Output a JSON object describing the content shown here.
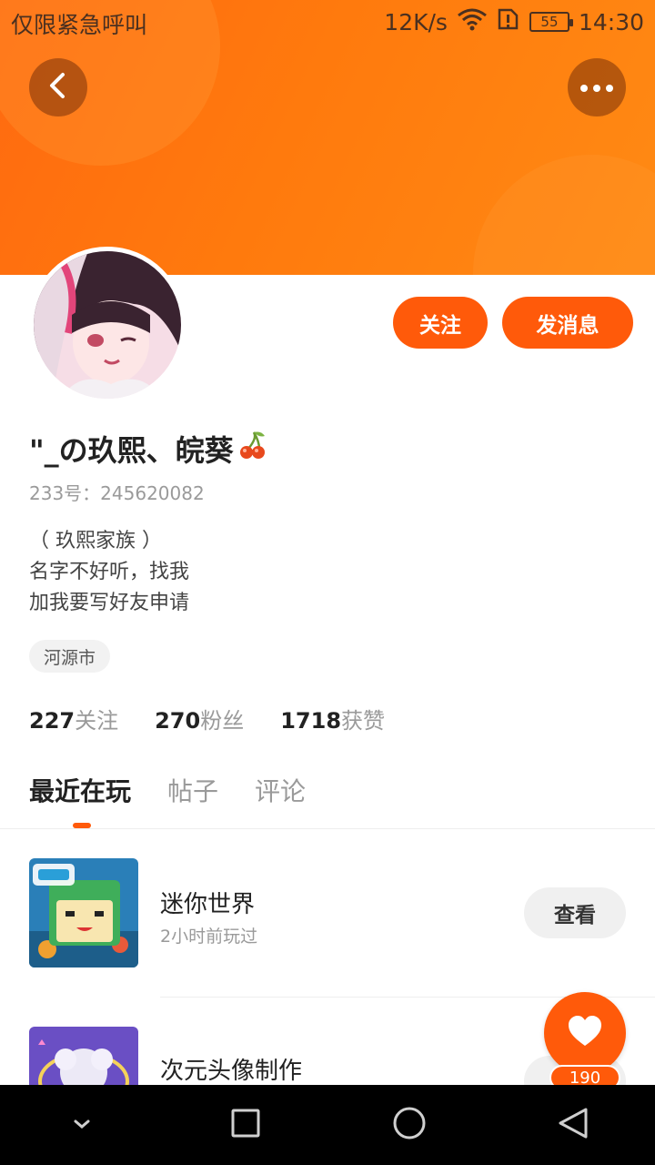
{
  "status_bar": {
    "left_text": "仅限紧急呼叫",
    "network_speed": "12K/s",
    "battery": "55",
    "time": "14:30"
  },
  "header": {
    "back_icon": "chevron-left-icon",
    "more_icon": "more-horizontal-icon",
    "accent_color": "#ff5a0a"
  },
  "profile": {
    "username": "\"_の玖熙、皖葵",
    "uid": "233号：245620082",
    "bio_lines": [
      "（ 玖熙家族 ）",
      "名字不好听，找我",
      "加我要写好友申请"
    ],
    "location": "河源市",
    "follow_label": "关注",
    "message_label": "发消息"
  },
  "stats": {
    "following_count": "227",
    "following_label": "关注",
    "followers_count": "270",
    "followers_label": "粉丝",
    "likes_count": "1718",
    "likes_label": "获赞"
  },
  "tabs": [
    {
      "label": "最近在玩",
      "active": true
    },
    {
      "label": "帖子",
      "active": false
    },
    {
      "label": "评论",
      "active": false
    }
  ],
  "games": [
    {
      "name": "迷你世界",
      "time": "2小时前玩过",
      "button": "查看"
    },
    {
      "name": "次元头像制作",
      "time": "",
      "button": ""
    }
  ],
  "fab": {
    "icon": "heart-icon",
    "count": "190"
  },
  "navbar": {
    "items": [
      "chevron-down-icon",
      "square-icon",
      "circle-icon",
      "triangle-back-icon"
    ]
  }
}
